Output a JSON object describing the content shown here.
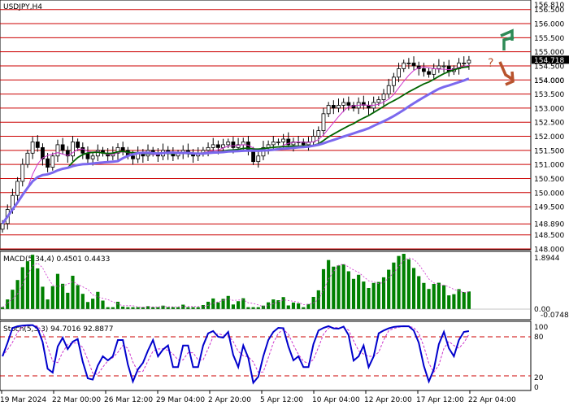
{
  "chart_data": {
    "type": "candlestick",
    "symbol_title": "USDJPY,H4",
    "price_panel": {
      "ylim": [
        148.0,
        156.81
      ],
      "top_label": "156.810",
      "level_lines": [
        156.5,
        156.0,
        155.5,
        155.0,
        154.5,
        154.0,
        153.5,
        153.0,
        152.5,
        152.0,
        151.5,
        151.0,
        150.5,
        150.0,
        149.5,
        148.89,
        148.5,
        148.0
      ],
      "level_labels": [
        "156.500",
        "156.000",
        "155.500",
        "155.000",
        "154.500",
        "154.000",
        "153.500",
        "153.000",
        "152.500",
        "152.000",
        "151.500",
        "151.000",
        "150.500",
        "150.000",
        "149.500",
        "148.890",
        "148.500",
        "148.000"
      ],
      "current_price": "154.718",
      "close_series": [
        148.9,
        149.4,
        149.9,
        150.4,
        151.0,
        151.4,
        151.8,
        151.6,
        151.2,
        150.9,
        151.3,
        151.7,
        151.5,
        151.3,
        151.8,
        151.6,
        151.4,
        151.2,
        151.3,
        151.5,
        151.4,
        151.3,
        151.4,
        151.6,
        151.5,
        151.3,
        151.2,
        151.4,
        151.3,
        151.5,
        151.4,
        151.3,
        151.5,
        151.4,
        151.3,
        151.4,
        151.5,
        151.4,
        151.3,
        151.4,
        151.5,
        151.6,
        151.7,
        151.6,
        151.7,
        151.8,
        151.6,
        151.7,
        151.8,
        151.5,
        151.1,
        151.3,
        151.6,
        151.7,
        151.8,
        151.8,
        151.9,
        151.7,
        151.8,
        151.8,
        151.7,
        151.8,
        152.0,
        152.2,
        152.8,
        153.1,
        153.0,
        153.1,
        153.2,
        153.1,
        153.0,
        153.2,
        153.1,
        153.0,
        153.2,
        153.3,
        153.5,
        153.8,
        154.1,
        154.4,
        154.6,
        154.6,
        154.5,
        154.4,
        154.3,
        154.2,
        154.4,
        154.5,
        154.5,
        154.3,
        154.4,
        154.6,
        154.6,
        154.7
      ],
      "sma_labels": [
        "154.000"
      ],
      "annotation": "?"
    },
    "indicators": [
      {
        "name": "MACD(5,34,4) 0.4501 0.4433",
        "type": "bar",
        "ylim": [
          -0.0748,
          1.8944
        ],
        "tick_labels": [
          "1.8944",
          "0.00",
          "-0.0748"
        ]
      },
      {
        "name": "Stoch(5,3,3) 94.7016 92.8877",
        "type": "line",
        "ylim": [
          0,
          100
        ],
        "tick_labels": [
          "100",
          "80",
          "20",
          "0"
        ]
      }
    ],
    "x_tick_labels": [
      "19 Mar 2024",
      "22 Mar 00:00",
      "26 Mar 12:00",
      "29 Mar 04:00",
      "2 Apr 20:00",
      "5 Apr 12:00",
      "10 Apr 04:00",
      "12 Apr 20:00",
      "17 Apr 12:00",
      "22 Apr 04:00"
    ],
    "colors": {
      "bull": "#008000",
      "bear": "#8b0000",
      "slow_ma": "#7b68ee",
      "mid_ma": "#006400",
      "fast_ma": "#cc33cc",
      "level": "#cc0000",
      "macd": "#008000",
      "stoch_main": "#0000cc",
      "stoch_signal": "#cc33cc"
    }
  }
}
